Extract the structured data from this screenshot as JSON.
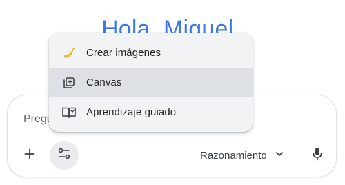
{
  "greeting": "Hola, Miguel",
  "composer": {
    "placeholder": "Pregunta a Gemini",
    "add_icon": "plus-icon",
    "tools_icon": "tune-icon",
    "model_label": "Razonamiento",
    "model_icon": "chevron-down-icon",
    "mic_icon": "microphone-icon"
  },
  "menu": {
    "items": [
      {
        "label": "Crear imágenes",
        "icon": "banana-icon"
      },
      {
        "label": "Canvas",
        "icon": "canvas-icon"
      },
      {
        "label": "Aprendizaje guiado",
        "icon": "book-icon"
      }
    ],
    "active_index": 1
  },
  "colors": {
    "greeting": "#3b78e7",
    "menu_background": "#f1f3f4",
    "menu_active": "#dde0e4",
    "tools_button": "#e9ebee"
  }
}
